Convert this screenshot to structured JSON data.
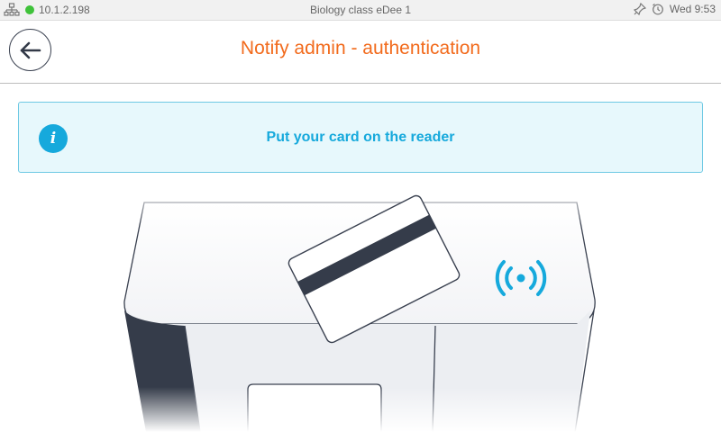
{
  "status_bar": {
    "ip": "10.1.2.198",
    "device_name": "Biology class eDee 1",
    "clock": "Wed 9:53",
    "icons": [
      "network-icon",
      "connected-dot-icon",
      "pin-icon",
      "alarm-clock-icon"
    ],
    "connected_color": "#3fc23a"
  },
  "header": {
    "title": "Notify admin - authentication",
    "back_icon": "arrow-left-icon",
    "title_color": "#f26b1d"
  },
  "info": {
    "message": "Put your card on the reader",
    "icon": "info-icon",
    "accent_color": "#16a9dc"
  },
  "illustration": {
    "icons": [
      "card-reader-device",
      "card-icon",
      "nfc-signal-icon"
    ]
  }
}
